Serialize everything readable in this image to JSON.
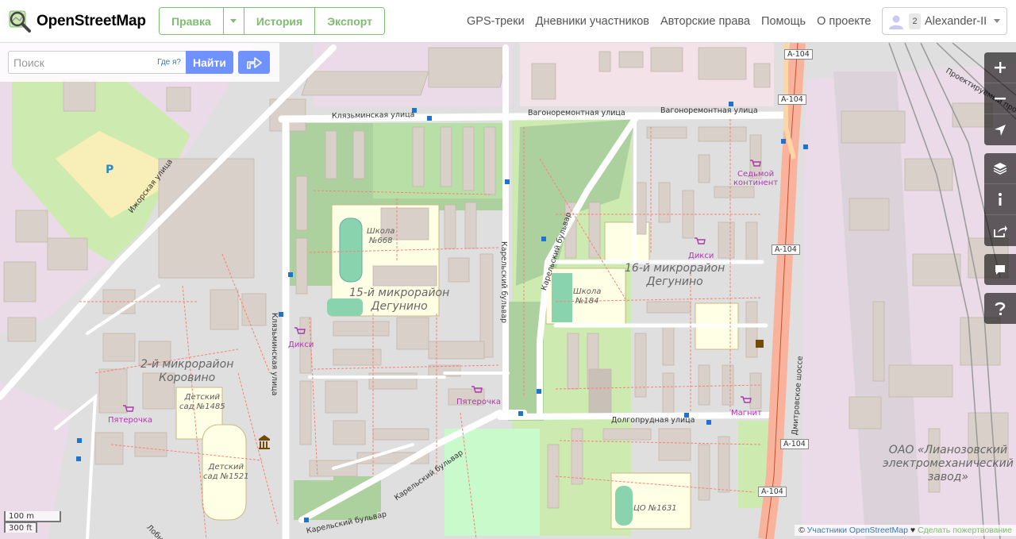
{
  "header": {
    "logo_text": "OpenStreetMap",
    "edit_label": "Правка",
    "history_label": "История",
    "export_label": "Экспорт",
    "nav": [
      "GPS-треки",
      "Дневники участников",
      "Авторские права",
      "Помощь",
      "О проекте"
    ],
    "inbox_count": "2",
    "username": "Alexander-II"
  },
  "search": {
    "placeholder": "Поиск",
    "where_am_i": "Где я?",
    "submit_label": "Найти"
  },
  "map": {
    "roads": {
      "kliazminskaya": "Клязьминская улица",
      "vagonoremontnaya_1": "Вагоноремонтная улица",
      "vagonoremontnaya_2": "Вагоноремонтная улица",
      "izhorskaya": "Ижорская улица",
      "kliazminskaya_v": "Клязьминская улица",
      "karelsky_1": "Карельский бульвар",
      "karelsky_2": "Карельский бульвар",
      "karelsky_3": "Карельский бульвар",
      "karelsky_4": "Карельский бульвар",
      "dolgoprudnaya": "Долгопрудная улица",
      "dmitrovskoe": "Дмитровское шоссе",
      "proektiruemy": "Проектируемый проезд",
      "lobnenskaya": "Лобн..."
    },
    "shields": [
      "A-104",
      "A-104",
      "A-104",
      "A-104",
      "A-104"
    ],
    "districts": {
      "d15_line1": "15-й микрорайон",
      "d15_line2": "Дегунино",
      "d16_line1": "16-й микрорайон",
      "d16_line2": "Дегунино",
      "d2_line1": "2-й микрорайон",
      "d2_line2": "Коровино"
    },
    "buildings": {
      "school668_1": "Школа",
      "school668_2": "№668",
      "school184_1": "Школа",
      "school184_2": "№184",
      "kg1485_1": "Детский",
      "kg1485_2": "сад №1485",
      "kg1521_1": "Детский",
      "kg1521_2": "сад №1521",
      "co1631": "ЦО №1631"
    },
    "shops": {
      "sedmoy_1": "Седьмой",
      "sedmoy_2": "континент",
      "diksi_1": "Дикси",
      "diksi_2": "Дикси",
      "pyaterochka_1": "Пятерочка",
      "pyaterochka_2": "Пятерочка",
      "magnit": "Магнит"
    },
    "factory": {
      "line1": "ОАО «Лианозовский",
      "line2": "электромеханический",
      "line3": "завод»"
    },
    "parking": "P",
    "colors": {
      "residential": "#e0dfdf",
      "park": "#c8facc",
      "grass": "#cdebb0",
      "forest": "#add19e",
      "school": "#ffffe5",
      "industrial": "#ebdbe8",
      "building": "#d9d0c9",
      "trunk": "#f9b29c",
      "primary": "#fcd6a4",
      "parking": "#f7efb7"
    }
  },
  "scale": {
    "metric": "100 m",
    "imperial": "300 ft"
  },
  "attribution": {
    "prefix": "©",
    "contributors": "Участники OpenStreetMap",
    "heart": "♥",
    "donate": "Сделать пожертвование"
  }
}
